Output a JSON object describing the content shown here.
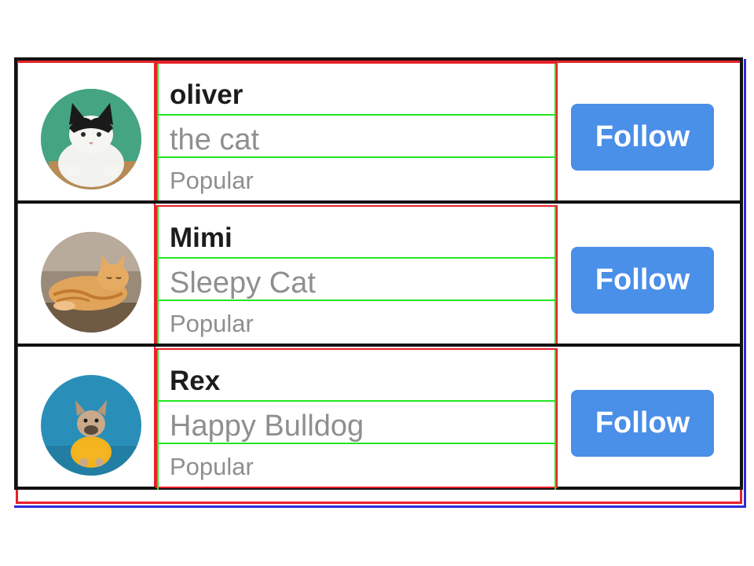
{
  "users": [
    {
      "name": "oliver",
      "subtitle": "the cat",
      "tag": "Popular",
      "button_label": "Follow",
      "avatar": "black-white-cat-photo"
    },
    {
      "name": "Mimi",
      "subtitle": "Sleepy Cat",
      "tag": "Popular",
      "button_label": "Follow",
      "avatar": "orange-tabby-cat-photo"
    },
    {
      "name": "Rex",
      "subtitle": "Happy Bulldog",
      "tag": "Popular",
      "button_label": "Follow",
      "avatar": "french-bulldog-photo"
    }
  ],
  "colors": {
    "button": "#4a8fe8",
    "name_text": "#1c1c1c",
    "secondary_text": "#8f8f8f",
    "row_border": "#111111",
    "debug_red": "#e8202a",
    "debug_green": "#22e622"
  }
}
